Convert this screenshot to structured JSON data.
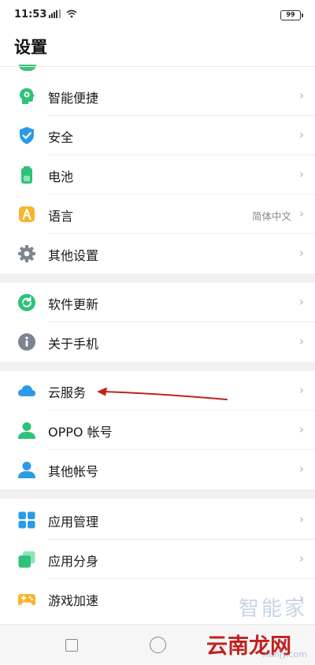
{
  "status_bar": {
    "time": "11:53",
    "battery": "99"
  },
  "page": {
    "title": "设置"
  },
  "groups": [
    [
      {
        "label": "智能便捷",
        "icon": "smart-assist-icon",
        "value": ""
      },
      {
        "label": "安全",
        "icon": "shield-icon",
        "value": ""
      },
      {
        "label": "电池",
        "icon": "battery-icon",
        "value": ""
      },
      {
        "label": "语言",
        "icon": "language-icon",
        "value": "简体中文"
      },
      {
        "label": "其他设置",
        "icon": "gear-icon",
        "value": ""
      }
    ],
    [
      {
        "label": "软件更新",
        "icon": "update-icon",
        "value": ""
      },
      {
        "label": "关于手机",
        "icon": "info-icon",
        "value": ""
      }
    ],
    [
      {
        "label": "云服务",
        "icon": "cloud-icon",
        "value": ""
      },
      {
        "label": "OPPO 帐号",
        "icon": "account-icon",
        "value": ""
      },
      {
        "label": "其他帐号",
        "icon": "other-account-icon",
        "value": ""
      }
    ],
    [
      {
        "label": "应用管理",
        "icon": "app-management-icon",
        "value": ""
      },
      {
        "label": "应用分身",
        "icon": "app-clone-icon",
        "value": ""
      },
      {
        "label": "游戏加速",
        "icon": "game-boost-icon",
        "value": ""
      }
    ]
  ],
  "chevron": "›",
  "watermark": {
    "top": "智能家",
    "main": "云南龙网",
    "sub": "Xunjy.com"
  },
  "colors": {
    "arrow": "#c0221f",
    "icon_green": "#2fc27a",
    "icon_blue": "#2b9be8",
    "gap": "#f1f1f1"
  }
}
